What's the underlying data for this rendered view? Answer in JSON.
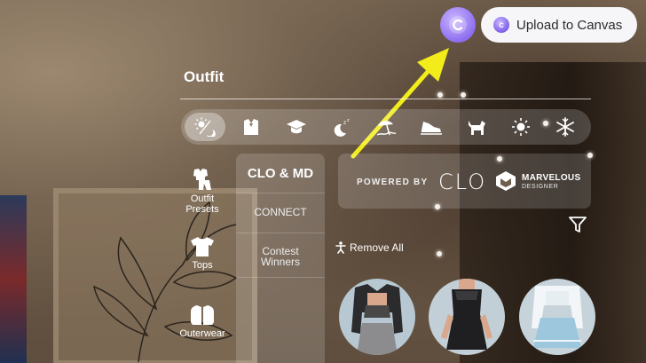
{
  "header": {
    "upload_label": "Upload to Canvas"
  },
  "panel": {
    "title": "Outfit",
    "filters": [
      {
        "icon": "weather-all-icon",
        "glyph": "☀",
        "active": true
      },
      {
        "icon": "formal-icon",
        "glyph": "▥",
        "active": false
      },
      {
        "icon": "graduation-icon",
        "glyph": "🎓",
        "active": false
      },
      {
        "icon": "sleep-icon",
        "glyph": "☾",
        "active": false
      },
      {
        "icon": "beach-icon",
        "glyph": "⛱",
        "active": false
      },
      {
        "icon": "sneaker-icon",
        "glyph": "👟",
        "active": false
      },
      {
        "icon": "pet-icon",
        "glyph": "🐕",
        "active": false
      },
      {
        "icon": "sun-icon",
        "glyph": "☼",
        "active": false
      },
      {
        "icon": "snowflake-icon",
        "glyph": "❄",
        "active": false
      }
    ],
    "nav": [
      {
        "label": "Outfit Presets",
        "line1": "Outfit",
        "line2": "Presets",
        "icon": "outfit-presets-icon"
      },
      {
        "label": "Tops",
        "line1": "Tops",
        "line2": "",
        "icon": "tops-icon"
      },
      {
        "label": "Outerwear",
        "line1": "Outerwear",
        "line2": "",
        "icon": "outerwear-icon"
      }
    ],
    "categories": {
      "header": "CLO & MD",
      "items": [
        {
          "line1": "CONNECT",
          "line2": ""
        },
        {
          "line1": "Contest",
          "line2": "Winners"
        }
      ]
    },
    "powered": {
      "label": "POWERED BY",
      "clo": "CLO",
      "md_line1": "MARVELOUS",
      "md_line2": "DESIGNER"
    },
    "remove_all_label": "Remove All"
  }
}
